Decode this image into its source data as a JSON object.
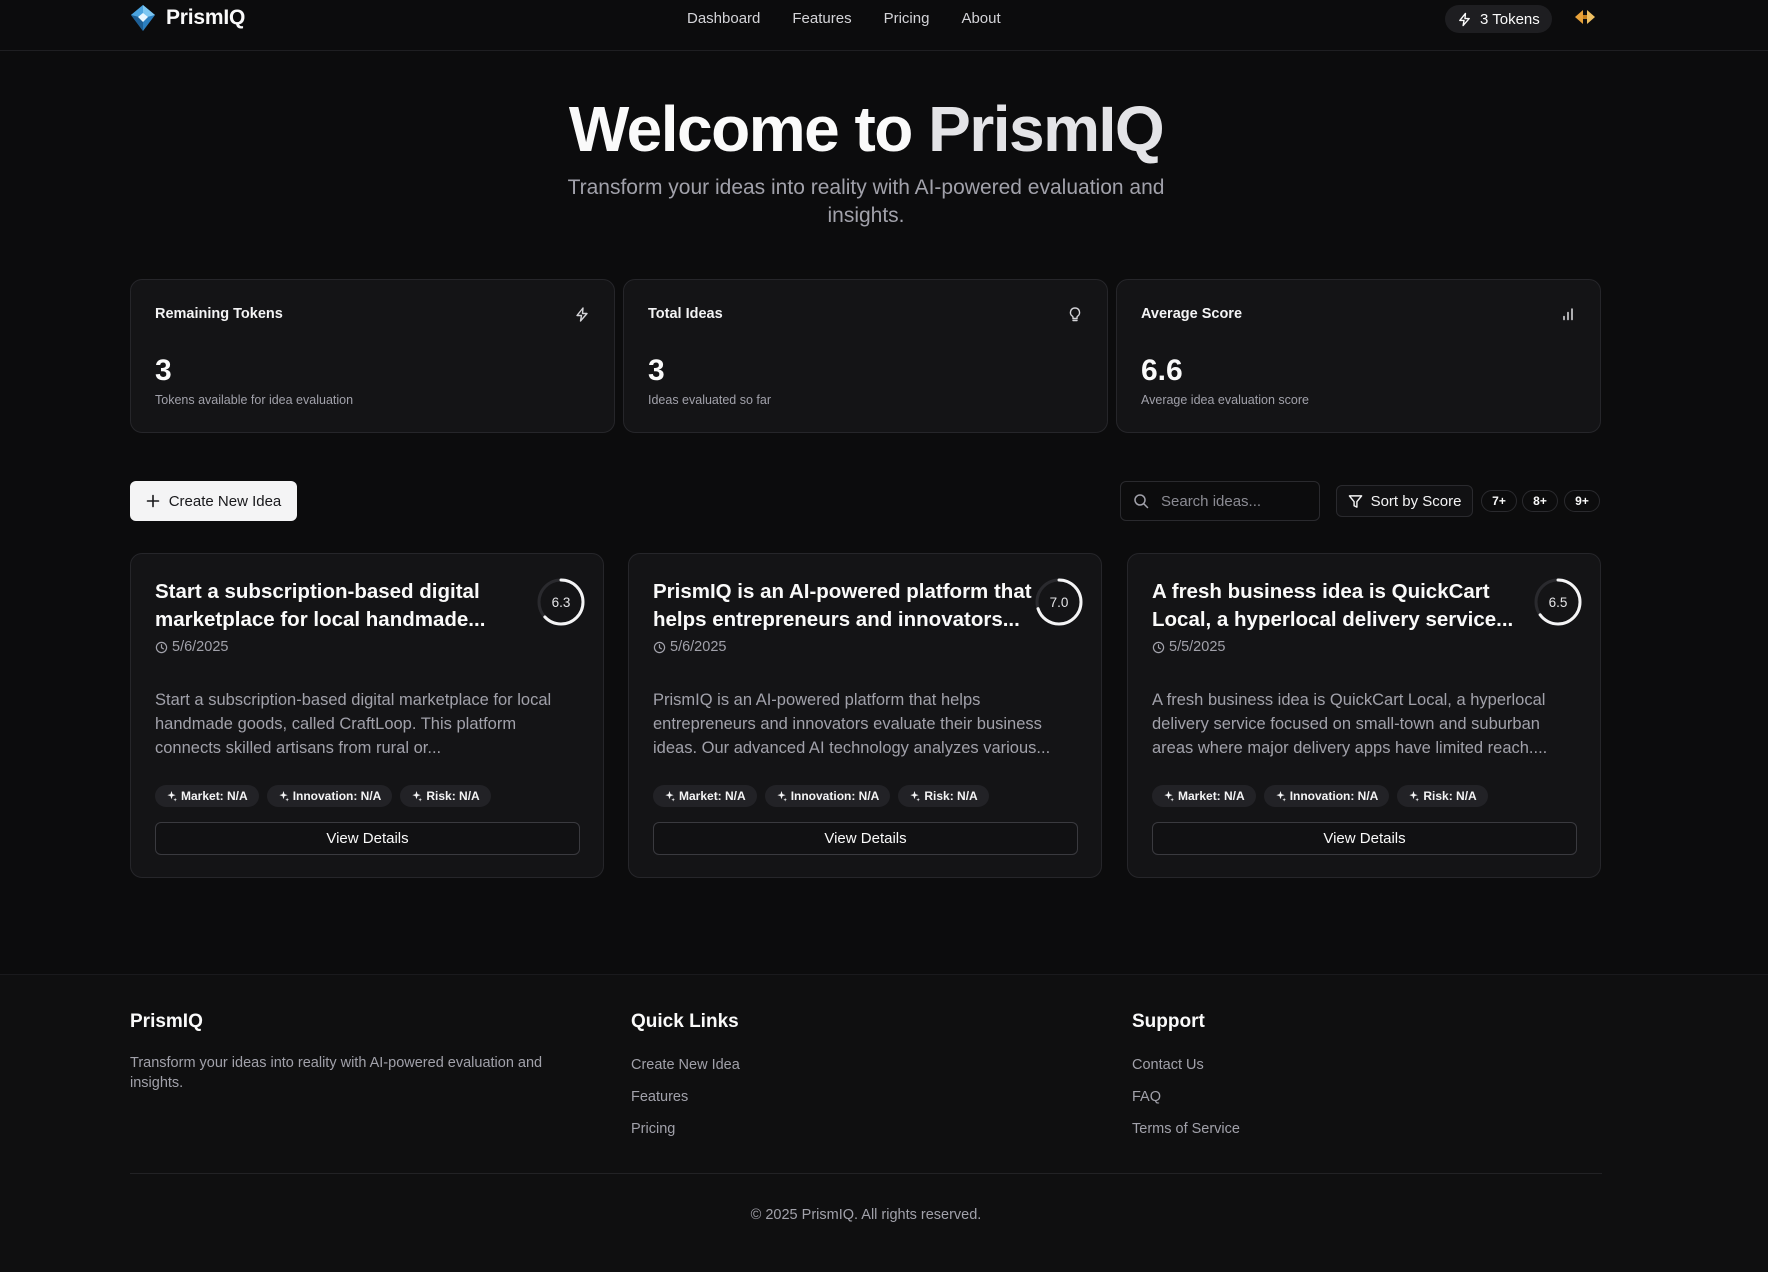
{
  "nav": {
    "brand": "PrismIQ",
    "links": [
      "Dashboard",
      "Features",
      "Pricing",
      "About"
    ],
    "tokens_label": "3 Tokens"
  },
  "hero": {
    "title_part1": "Welcome to",
    "title_part2": "PrismIQ",
    "subtitle": "Transform your ideas into reality with AI-powered evaluation and insights."
  },
  "stats": [
    {
      "label": "Remaining Tokens",
      "value": "3",
      "note": "Tokens available for idea evaluation",
      "icon": "zap-icon"
    },
    {
      "label": "Total Ideas",
      "value": "3",
      "note": "Ideas evaluated so far",
      "icon": "lightbulb-icon"
    },
    {
      "label": "Average Score",
      "value": "6.6",
      "note": "Average idea evaluation score",
      "icon": "bar-chart-icon"
    }
  ],
  "toolbar": {
    "create_label": "Create New Idea",
    "search_placeholder": "Search ideas...",
    "sort_label": "Sort by Score",
    "filters": [
      "7+",
      "8+",
      "9+"
    ]
  },
  "ideas": [
    {
      "title": "Start a subscription-based digital marketplace for local handmade...",
      "score": "6.3",
      "score_value": 6.3,
      "date": "5/6/2025",
      "description": "Start a subscription-based digital marketplace for local handmade goods, called CraftLoop. This platform connects skilled artisans from rural or...",
      "tags": [
        "Market: N/A",
        "Innovation: N/A",
        "Risk: N/A"
      ],
      "action": "View Details"
    },
    {
      "title": "PrismIQ is an AI-powered platform that helps entrepreneurs and innovators...",
      "score": "7.0",
      "score_value": 7.0,
      "date": "5/6/2025",
      "description": "PrismIQ is an AI-powered platform that helps entrepreneurs and innovators evaluate their business ideas. Our advanced AI technology analyzes various...",
      "tags": [
        "Market: N/A",
        "Innovation: N/A",
        "Risk: N/A"
      ],
      "action": "View Details"
    },
    {
      "title": "A fresh business idea is QuickCart Local, a hyperlocal delivery service...",
      "score": "6.5",
      "score_value": 6.5,
      "date": "5/5/2025",
      "description": "A fresh business idea is QuickCart Local, a hyperlocal delivery service focused on small-town and suburban areas where major delivery apps have limited reach....",
      "tags": [
        "Market: N/A",
        "Innovation: N/A",
        "Risk: N/A"
      ],
      "action": "View Details"
    }
  ],
  "footer": {
    "brand": "PrismIQ",
    "tagline": "Transform your ideas into reality with AI-powered evaluation and insights.",
    "quick_links_title": "Quick Links",
    "quick_links": [
      "Create New Idea",
      "Features",
      "Pricing"
    ],
    "support_title": "Support",
    "support_links": [
      "Contact Us",
      "FAQ",
      "Terms of Service"
    ],
    "copyright": "© 2025 PrismIQ. All rights reserved."
  },
  "colors": {
    "background": "#0c0c0d",
    "card": "#141416",
    "logo_blue": "#4aa3df",
    "lang_orange": "#e8a23a"
  }
}
